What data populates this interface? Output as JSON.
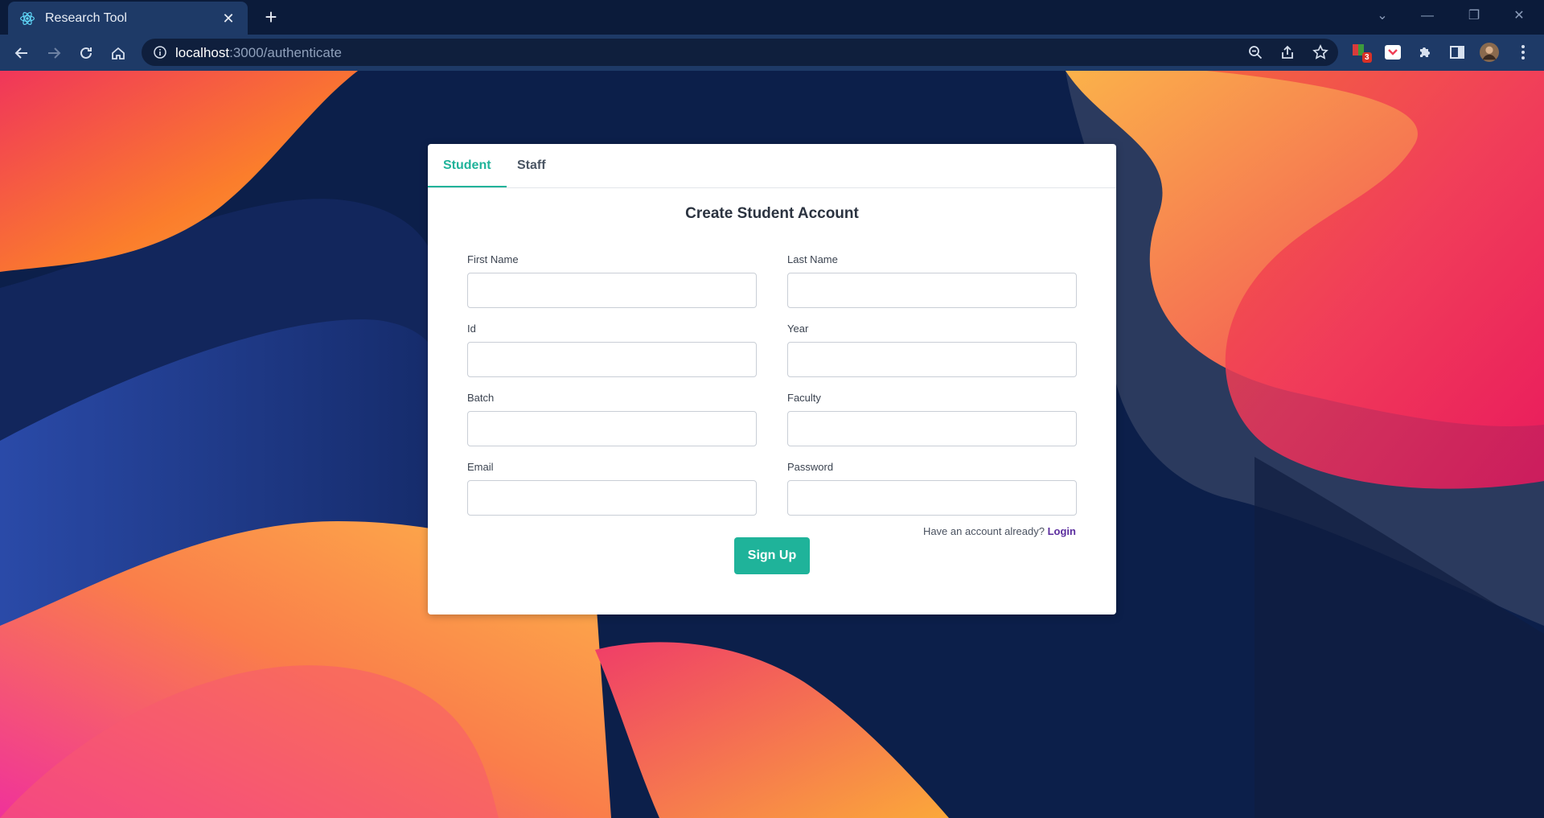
{
  "browser": {
    "tab_title": "Research Tool",
    "url_host": "localhost",
    "url_path": ":3000/authenticate",
    "extension_badge": "3"
  },
  "auth": {
    "tabs": [
      {
        "label": "Student"
      },
      {
        "label": "Staff"
      }
    ],
    "heading": "Create Student Account",
    "fields": {
      "first_name": "First Name",
      "last_name": "Last Name",
      "id": "Id",
      "year": "Year",
      "batch": "Batch",
      "faculty": "Faculty",
      "email": "Email",
      "password": "Password"
    },
    "login_prompt": "Have an account already?",
    "login_link": "Login",
    "signup_button": "Sign Up"
  },
  "colors": {
    "accent": "#1fb39a",
    "login_link": "#5b2d9e",
    "chrome": "#1e3a67"
  }
}
